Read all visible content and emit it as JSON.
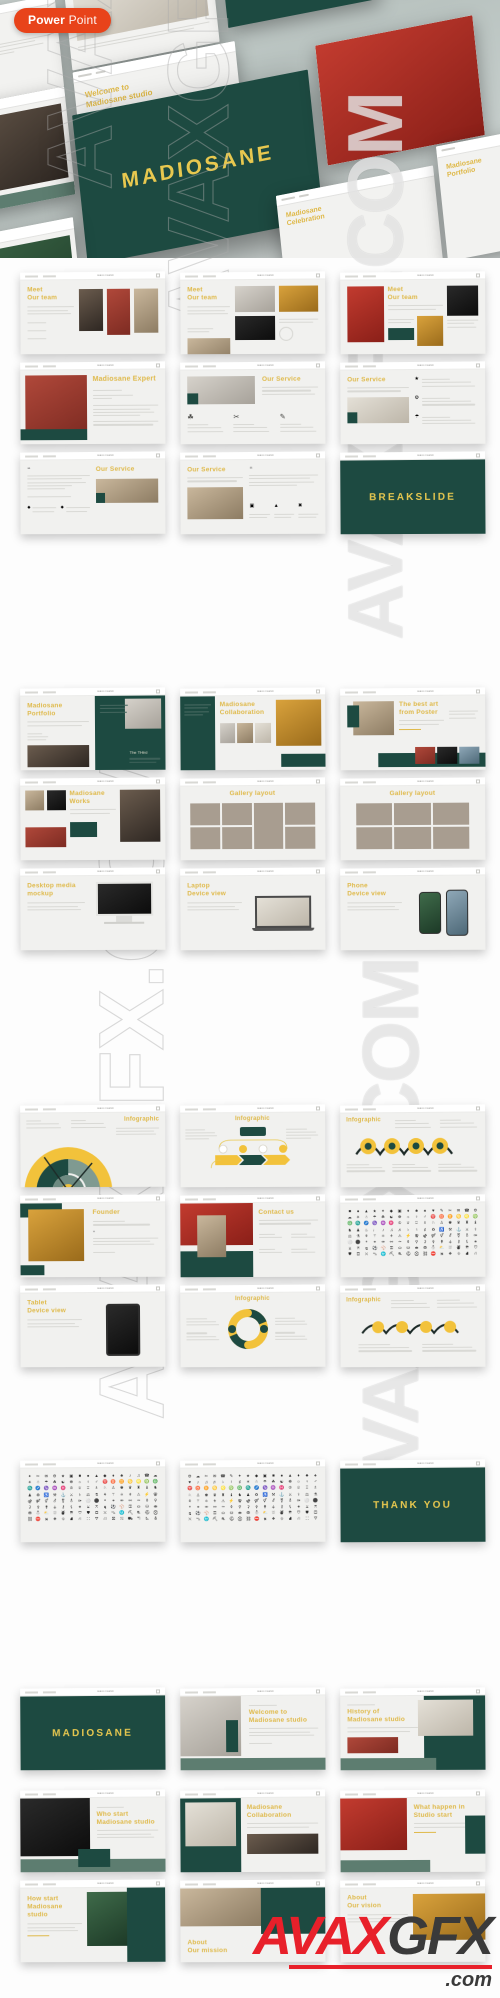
{
  "badge": {
    "bold": "Power",
    "light": "Point"
  },
  "brand": {
    "name": "MADIOSANE",
    "teal": "#1d4a41",
    "gold": "#e8c84f",
    "gold_soft": "#dfb949",
    "badge_orange": "#e8431a",
    "page_bg": "#ffffff"
  },
  "hero": {
    "cover_title": "MADIOSANE",
    "slides": [
      {
        "title": "Welcome to Madiosane studio"
      },
      {
        "title": "History of Madiosane studio"
      },
      {
        "title": "About Our mission"
      },
      {
        "title": "Who start Madiosane studio"
      },
      {
        "title": "What happen in Studio start"
      },
      {
        "title": "Madiosane Celebration"
      },
      {
        "title": "Madiosane Portfolio"
      }
    ],
    "nav_items": [
      "Madiosane",
      "Our Studio",
      "Our Team"
    ]
  },
  "watermarks": {
    "logo": {
      "part_red": "AVAX",
      "part_dark": "GFX",
      "suffix": ".com"
    },
    "tiles": [
      "AVAXGFX.COM",
      "AVAXGFX.COM",
      "AVAXGFX.COM",
      "AVAXGFX.COM"
    ]
  },
  "slide_topbar": {
    "nav_left": "Madiosane",
    "nav_right": "Our Studio",
    "center_title": "MADIOSANE"
  },
  "sections": [
    {
      "id": "team-services",
      "rows": [
        {
          "slides": [
            {
              "name": "meet-our-team-1",
              "title_line1": "Meet",
              "title_line2": "Our team",
              "layout": "team-3col"
            },
            {
              "name": "meet-our-team-2",
              "title_line1": "Meet",
              "title_line2": "Our team",
              "layout": "team-grid"
            },
            {
              "name": "meet-our-team-3",
              "title_line1": "Meet",
              "title_line2": "Our team",
              "layout": "team-mixed"
            }
          ]
        },
        {
          "slides": [
            {
              "name": "madiosane-expert",
              "title_line1": "Madiosane Expert",
              "title_line2": "",
              "layout": "expert"
            },
            {
              "name": "our-service-1",
              "title_line1": "Our Service",
              "title_line2": "",
              "layout": "service-icons"
            },
            {
              "name": "our-service-2",
              "title_line1": "Our Service",
              "title_line2": "",
              "layout": "service-list"
            }
          ]
        },
        {
          "slides": [
            {
              "name": "our-service-3",
              "title_line1": "Our Service",
              "title_line2": "",
              "layout": "service-quote-right"
            },
            {
              "name": "our-service-4",
              "title_line1": "Our Service",
              "title_line2": "",
              "layout": "service-quote-left"
            },
            {
              "name": "breakslide",
              "title_line1": "BREAKSLIDE",
              "title_line2": "",
              "layout": "break"
            }
          ]
        }
      ]
    },
    {
      "id": "portfolio-gallery",
      "rows": [
        {
          "slides": [
            {
              "name": "madiosane-portfolio",
              "title_line1": "Madiosane",
              "title_line2": "Portfolio",
              "layout": "portfolio"
            },
            {
              "name": "madiosane-collaboration",
              "title_line1": "Madiosane",
              "title_line2": "Collaboration",
              "layout": "collab"
            },
            {
              "name": "best-art-from-poster",
              "title_line1": "The best art",
              "title_line2": "from Poster",
              "layout": "poster"
            }
          ]
        },
        {
          "slides": [
            {
              "name": "madiosane-works",
              "title_line1": "Madiosane",
              "title_line2": "Works",
              "layout": "works"
            },
            {
              "name": "gallery-layout-1",
              "title_line1": "Gallery layout",
              "title_line2": "",
              "layout": "gallery8"
            },
            {
              "name": "gallery-layout-2",
              "title_line1": "Gallery layout",
              "title_line2": "",
              "layout": "gallery6"
            }
          ]
        },
        {
          "slides": [
            {
              "name": "desktop-media-mockup",
              "title_line1": "Desktop media",
              "title_line2": "mockup",
              "layout": "desktop"
            },
            {
              "name": "laptop-device-view",
              "title_line1": "Laptop",
              "title_line2": "Device view",
              "layout": "laptop"
            },
            {
              "name": "phone-device-view",
              "title_line1": "Phone",
              "title_line2": "Device view",
              "layout": "phone"
            }
          ]
        }
      ]
    },
    {
      "id": "infographics",
      "rows": [
        {
          "slides": [
            {
              "name": "infographic-gauge",
              "title_line1": "Infographic",
              "title_line2": "",
              "layout": "gauge"
            },
            {
              "name": "infographic-flow",
              "title_line1": "Infographic",
              "title_line2": "",
              "layout": "flow"
            },
            {
              "name": "infographic-circles",
              "title_line1": "Infographic",
              "title_line2": "",
              "layout": "circles"
            }
          ]
        },
        {
          "slides": [
            {
              "name": "founder",
              "title_line1": "Founder",
              "title_line2": "",
              "layout": "founder"
            },
            {
              "name": "contact-us",
              "title_line1": "Contact us",
              "title_line2": "",
              "layout": "contact"
            },
            {
              "name": "icon-pack-1",
              "title_line1": "",
              "title_line2": "",
              "layout": "icons"
            }
          ]
        },
        {
          "slides": [
            {
              "name": "tablet-device-view",
              "title_line1": "Tablet",
              "title_line2": "Device view",
              "layout": "tablet"
            },
            {
              "name": "infographic-donut",
              "title_line1": "Infographic",
              "title_line2": "",
              "layout": "donut"
            },
            {
              "name": "infographic-wave",
              "title_line1": "Infographic",
              "title_line2": "",
              "layout": "wave"
            }
          ]
        }
      ]
    },
    {
      "id": "icons-thankyou",
      "rows": [
        {
          "slides": [
            {
              "name": "icon-pack-2",
              "title_line1": "",
              "title_line2": "",
              "layout": "icons"
            },
            {
              "name": "icon-pack-3",
              "title_line1": "",
              "title_line2": "",
              "layout": "icons"
            },
            {
              "name": "thank-you",
              "title_line1": "THANK YOU",
              "title_line2": "",
              "layout": "break"
            }
          ]
        }
      ]
    },
    {
      "id": "second-deck",
      "rows": [
        {
          "slides": [
            {
              "name": "cover-madiosane",
              "title_line1": "MADIOSANE",
              "title_line2": "",
              "layout": "break"
            },
            {
              "name": "welcome-to-studio",
              "title_line1": "Welcome to",
              "title_line2": "Madiosane studio",
              "layout": "welcome"
            },
            {
              "name": "history-of-studio",
              "title_line1": "History of",
              "title_line2": "Madiosane studio",
              "layout": "history"
            }
          ]
        },
        {
          "slides": [
            {
              "name": "who-start-studio",
              "title_line1": "Who start",
              "title_line2": "Madiosane studio",
              "layout": "who"
            },
            {
              "name": "madiosane-collaboration-2",
              "title_line1": "Madiosane",
              "title_line2": "Collaboration",
              "layout": "collab2"
            },
            {
              "name": "what-happen-studio",
              "title_line1": "What happen in",
              "title_line2": "Studio start",
              "layout": "happen"
            }
          ]
        },
        {
          "slides": [
            {
              "name": "how-start-studio",
              "title_line1": "How start",
              "title_line2": "Madiosane studio",
              "layout": "how"
            },
            {
              "name": "about-our-mission",
              "title_line1": "About",
              "title_line2": "Our mission",
              "layout": "mission"
            },
            {
              "name": "about-our-vision",
              "title_line1": "About",
              "title_line2": "Our vision",
              "layout": "vision"
            }
          ]
        }
      ]
    }
  ]
}
